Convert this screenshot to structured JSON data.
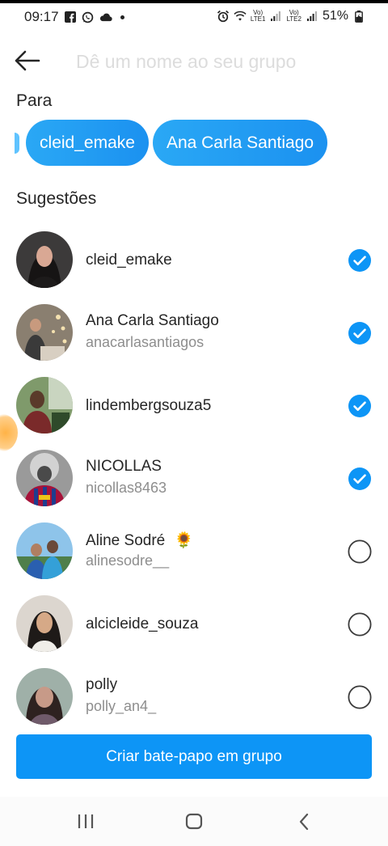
{
  "status_bar": {
    "time": "09:17",
    "left_icons": [
      "facebook-icon",
      "whatsapp-icon",
      "cloud-icon",
      "dot-icon"
    ],
    "lte1": "LTE1",
    "lte2": "LTE2",
    "vo": "Vo)",
    "battery": "51%"
  },
  "header": {
    "back_icon": "arrow-left-icon",
    "group_name_value": "",
    "group_name_placeholder": "Dê um nome ao seu grupo"
  },
  "to_section": {
    "title": "Para",
    "chips": [
      "cleid_emake",
      "Ana Carla Santiago"
    ]
  },
  "suggestions": {
    "title": "Sugestões",
    "items": [
      {
        "name": "cleid_emake",
        "handle": "",
        "selected": true
      },
      {
        "name": "Ana Carla Santiago",
        "handle": "anacarlasantiagos",
        "selected": true
      },
      {
        "name": "lindembergsouza5",
        "handle": "",
        "selected": true
      },
      {
        "name": "NICOLLAS",
        "handle": "nicollas8463",
        "selected": true
      },
      {
        "name": "Aline Sodré",
        "emoji": "🌻",
        "handle": "alinesodre__",
        "selected": false
      },
      {
        "name": "alcicleide_souza",
        "handle": "",
        "selected": false
      },
      {
        "name": "polly",
        "handle": "polly_an4_",
        "selected": false
      }
    ]
  },
  "create_button": "Criar bate-papo em grupo",
  "colors": {
    "accent": "#0d95f6",
    "text": "#262626",
    "secondary": "#8e8e8e",
    "placeholder": "#dcdcdc"
  },
  "nav_bar": [
    "recents-icon",
    "home-icon",
    "back-icon"
  ]
}
